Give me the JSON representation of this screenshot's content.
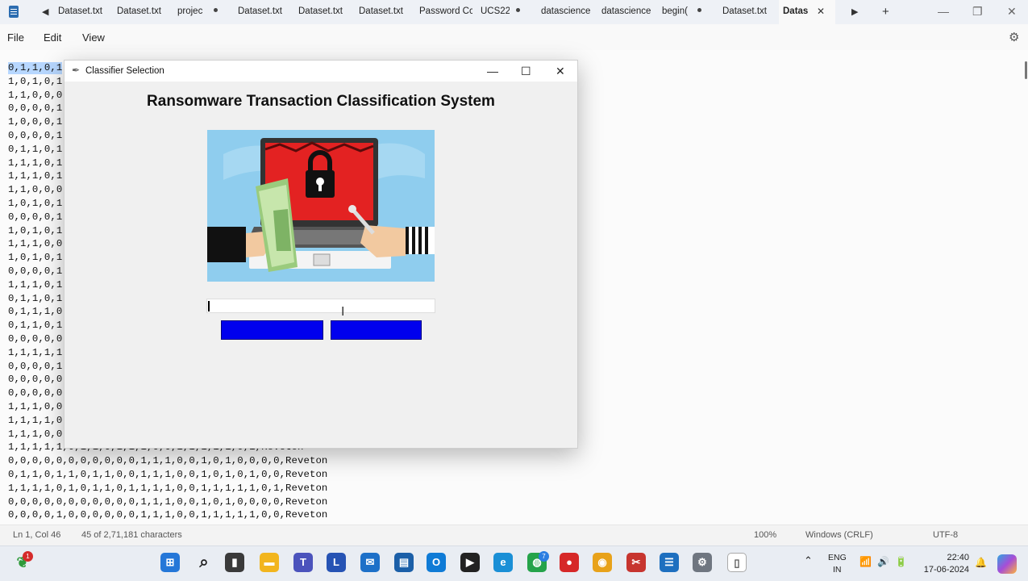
{
  "tabs": [
    {
      "label": "Dataset.txt",
      "modified": false
    },
    {
      "label": "Dataset.txt",
      "modified": false
    },
    {
      "label": "projec",
      "modified": true
    },
    {
      "label": "Dataset.txt",
      "modified": false
    },
    {
      "label": "Dataset.txt",
      "modified": false
    },
    {
      "label": "Dataset.txt",
      "modified": false
    },
    {
      "label": "Password Cc",
      "modified": false
    },
    {
      "label": "UCS22",
      "modified": true
    },
    {
      "label": "datascience",
      "modified": false
    },
    {
      "label": "datascience",
      "modified": false
    },
    {
      "label": "begin(",
      "modified": true
    },
    {
      "label": "Dataset.txt",
      "modified": false
    },
    {
      "label": "Datas",
      "modified": false,
      "active": true
    }
  ],
  "tab_controls": {
    "scroll_left": "◀",
    "scroll_right": "▶",
    "new_tab": "+",
    "close_active": "✕"
  },
  "window_controls": {
    "minimize": "—",
    "restore": "❐",
    "close": "✕"
  },
  "menu": {
    "file": "File",
    "edit": "Edit",
    "view": "View"
  },
  "editor_lines": [
    "0,1,1,0,1",
    "1,0,1,0,1",
    "1,1,0,0,0",
    "0,0,0,0,1",
    "1,0,0,0,1",
    "0,0,0,0,1",
    "0,1,1,0,1",
    "1,1,1,0,1",
    "1,1,1,0,1",
    "1,1,0,0,0",
    "1,0,1,0,1",
    "0,0,0,0,1",
    "1,0,1,0,1",
    "1,1,1,0,0",
    "1,0,1,0,1",
    "0,0,0,0,1",
    "1,1,1,0,1",
    "0,1,1,0,1",
    "0,1,1,1,0",
    "0,1,1,0,1",
    "0,0,0,0,0",
    "1,1,1,1,1",
    "0,0,0,0,1",
    "0,0,0,0,0",
    "0,0,0,0,0",
    "1,1,1,0,0",
    "1,1,1,1,0",
    "1,1,1,0,0",
    "1,1,1,1,1,0,1,1,0,1,1,1,0,0,1,1,1,1,1,0,1,Reveton",
    "0,0,0,0,0,0,0,0,0,0,0,1,1,1,0,0,1,0,1,0,0,0,0,Reveton",
    "0,1,1,0,1,1,0,1,1,0,0,1,1,1,0,0,1,0,1,0,1,0,0,Reveton",
    "1,1,1,1,0,1,0,1,1,0,1,1,1,1,0,0,1,1,1,1,1,0,1,Reveton",
    "0,0,0,0,0,0,0,0,0,0,0,1,1,1,0,0,1,0,1,0,0,0,0,Reveton",
    "0,0,0,0,1,0,0,0,0,0,0,1,1,1,0,0,1,1,1,1,1,0,0,Reveton"
  ],
  "status": {
    "position": "Ln 1, Col 46",
    "characters": "45 of 2,71,181 characters",
    "zoom": "100%",
    "line_ending": "Windows (CRLF)",
    "encoding": "UTF-8"
  },
  "dialog": {
    "title": "Classifier Selection",
    "heading": "Ransomware Transaction Classification System",
    "entry_value": "",
    "button1_label": "",
    "button2_label": "",
    "minimize": "—",
    "maximize": "☐",
    "close": "✕"
  },
  "taskbar": {
    "app_badge": "1",
    "whatsapp_badge": "7",
    "lang_top": "ENG",
    "lang_bottom": "IN",
    "time": "22:40",
    "date": "17-06-2024",
    "icons": [
      "start-icon",
      "search-icon",
      "task-view-icon",
      "file-explorer-icon",
      "teams-icon",
      "l-app-icon",
      "mail-icon",
      "news-icon",
      "outlook-icon",
      "media-player-icon",
      "edge-icon",
      "whatsapp-icon",
      "recorder-icon",
      "chrome-icon",
      "snip-icon",
      "notepad-icon",
      "settings-icon",
      "notepad-document-icon"
    ]
  },
  "colors": {
    "accent_blue": "#0000ee",
    "selection": "#b7d7ff",
    "dialog_bg": "#f0f0f0",
    "taskbar_bg": "#e9edf3"
  }
}
